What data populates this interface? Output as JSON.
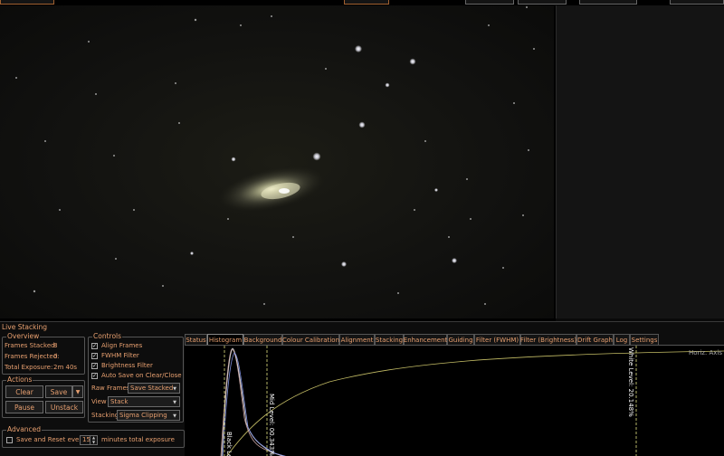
{
  "panel": {
    "title": "Live Stacking"
  },
  "overview": {
    "title": "Overview",
    "frames_stacked_label": "Frames Stacked:",
    "frames_stacked": "8",
    "frames_rejected_label": "Frames Rejected:",
    "frames_rejected": "0",
    "total_exposure_label": "Total Exposure:",
    "total_exposure": "2m 40s"
  },
  "actions": {
    "title": "Actions",
    "clear": "Clear",
    "save": "Save",
    "pause": "Pause",
    "unstack": "Unstack"
  },
  "controls": {
    "title": "Controls",
    "align_frames": "Align Frames",
    "fwhm_filter": "FWHM Filter",
    "brightness_filter": "Brightness Filter",
    "auto_save": "Auto Save on Clear/Close",
    "raw_frames_label": "Raw Frames",
    "raw_frames_value": "Save Stacked",
    "view_label": "View",
    "view_value": "Stack",
    "stacking_label": "Stacking",
    "stacking_value": "Sigma Clipping"
  },
  "advanced": {
    "title": "Advanced",
    "save_reset_label": "Save and Reset every",
    "minutes_value": "15",
    "minutes_suffix": "minutes total exposure"
  },
  "tabs": [
    "Status",
    "Histogram",
    "Background",
    "Colour Calibration",
    "Alignment",
    "Stacking",
    "Enhancement",
    "Guiding",
    "Filter (FWHM)",
    "Filter (Brightness)",
    "Drift Graph",
    "Log",
    "Settings"
  ],
  "active_tab": "Histogram",
  "histogram": {
    "white_level": "White Level: 20.148%",
    "mid_level": "Mid Level: 00.343%",
    "black_level": "Black Le",
    "horiz_axis": "Horiz. Axis"
  },
  "colors": {
    "accent_text": "#e8a070",
    "background": "#0d0d0d",
    "curve": "#d8d070"
  }
}
